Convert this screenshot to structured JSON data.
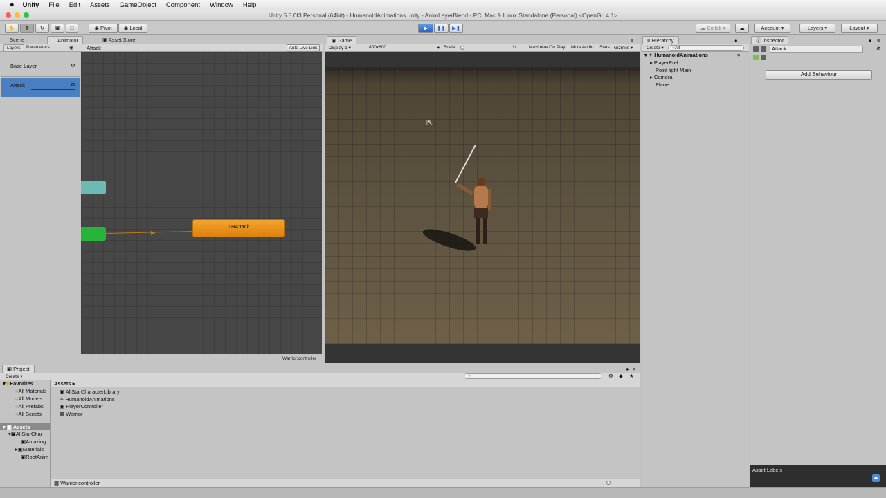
{
  "menubar": {
    "apple": "",
    "app": "Unity",
    "items": [
      "File",
      "Edit",
      "Assets",
      "GameObject",
      "Component",
      "Window",
      "Help"
    ]
  },
  "title": "Unity 5.5.0f3 Personal (64bit) - HumanoidAnimations.unity - AnimLayerBlend - PC, Mac & Linux Standalone (Personal) <OpenGL 4.1>",
  "toolbar": {
    "pivot": "Pivot",
    "local": "Local",
    "collab": "Collab",
    "account": "Account",
    "layers": "Layers",
    "layout": "Layout"
  },
  "animator": {
    "tabs": [
      "Scene",
      "Animator",
      "Asset Store"
    ],
    "sub_tabs": [
      "Layers",
      "Parameters"
    ],
    "breadcrumb": "Attack",
    "auto_live_link": "Auto Live Link",
    "layers": [
      "Base Layer",
      "Attack"
    ],
    "state_label": "1HAttack",
    "footer": "Warrior.controller"
  },
  "game": {
    "tab": "Game",
    "display": "Display 1",
    "resolution": "800x600",
    "scale_label": "Scale",
    "scale_value": "1x",
    "toggles": [
      "Maximize On Play",
      "Mute Audio",
      "Stats",
      "Gizmos"
    ]
  },
  "hierarchy": {
    "tab": "Hierarchy",
    "create": "Create",
    "search": "All",
    "scene": "HumanoidAnimations",
    "items": [
      "PlayerPref",
      "Point light Main",
      "Camera",
      "Plane"
    ]
  },
  "inspector": {
    "tab": "Inspector",
    "object_name": "Attack",
    "add_behaviour": "Add Behaviour",
    "asset_labels": "Asset Labels"
  },
  "project": {
    "tab": "Project",
    "create": "Create",
    "favorites_title": "Favorites",
    "favorites": [
      "All Materials",
      "All Models",
      "All Prefabs",
      "All Scripts"
    ],
    "assets_title": "Assets",
    "tree": [
      "AllStarChar",
      "Amazing",
      "Materials",
      "RootAnim"
    ],
    "breadcrumb": "Assets",
    "files": [
      "AllStarCharacterLibrary",
      "HumanoidAnimations",
      "PlayerController",
      "Warrior"
    ],
    "footer": "Warrior.controller"
  },
  "colors": {
    "selected_blue": "#4a7fc1",
    "state_orange": "#e88e12",
    "entry_green": "#27b43a",
    "any_state_teal": "#6dbab2",
    "play_blue": "#3777d2"
  }
}
